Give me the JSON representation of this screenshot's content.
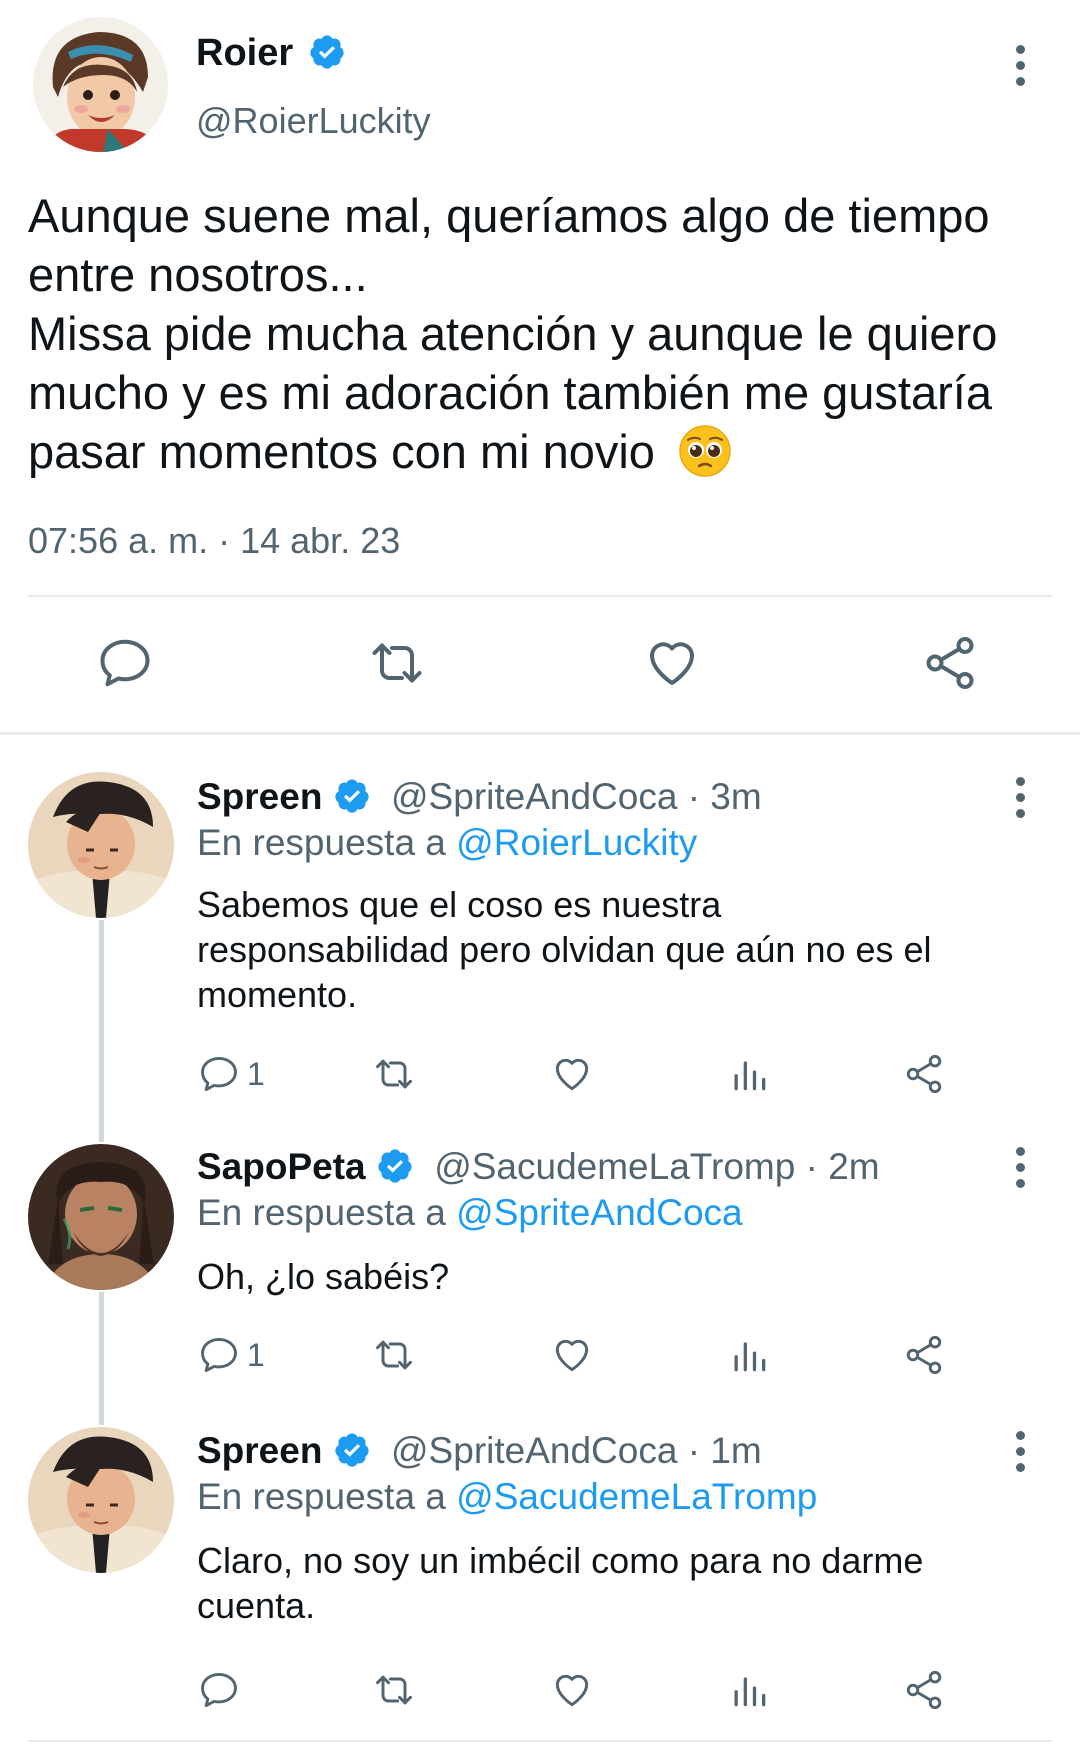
{
  "colors": {
    "accent": "#1d9bf0",
    "text": "#0f1419",
    "muted": "#536471",
    "divider": "#e6ecf0"
  },
  "main_tweet": {
    "name": "Roier",
    "handle": "@RoierLuckity",
    "text_lines": [
      "Aunque suene mal, queríamos algo de tiempo",
      "entre nosotros...",
      "Missa pide mucha atención y aunque le quiero",
      "mucho y es mi adoración también me gustaría",
      "pasar momentos con mi novio"
    ],
    "emoji": "pleading-face-emoji",
    "timestamp": "07:56 a. m. · 14 abr. 23",
    "actions": [
      "reply-icon",
      "retweet-icon",
      "like-icon",
      "share-icon"
    ]
  },
  "replies": [
    {
      "name": "Spreen",
      "meta": "@SpriteAndCoca · 3m",
      "in_reply_prefix": "En respuesta a ",
      "in_reply_to": "@RoierLuckity",
      "text_lines": [
        "Sabemos que el coso es nuestra",
        "responsabilidad pero olvidan que aún no es el",
        "momento."
      ],
      "reply_count": "1"
    },
    {
      "name": "SapoPeta",
      "meta": "@SacudemeLaTromp · 2m",
      "in_reply_prefix": "En respuesta a ",
      "in_reply_to": "@SpriteAndCoca",
      "text_lines": [
        "Oh, ¿lo sabéis?"
      ],
      "reply_count": "1"
    },
    {
      "name": "Spreen",
      "meta": "@SpriteAndCoca · 1m",
      "in_reply_prefix": "En respuesta a ",
      "in_reply_to": "@SacudemeLaTromp",
      "text_lines": [
        "Claro, no soy un imbécil como para no darme",
        "cuenta."
      ],
      "reply_count": ""
    }
  ]
}
